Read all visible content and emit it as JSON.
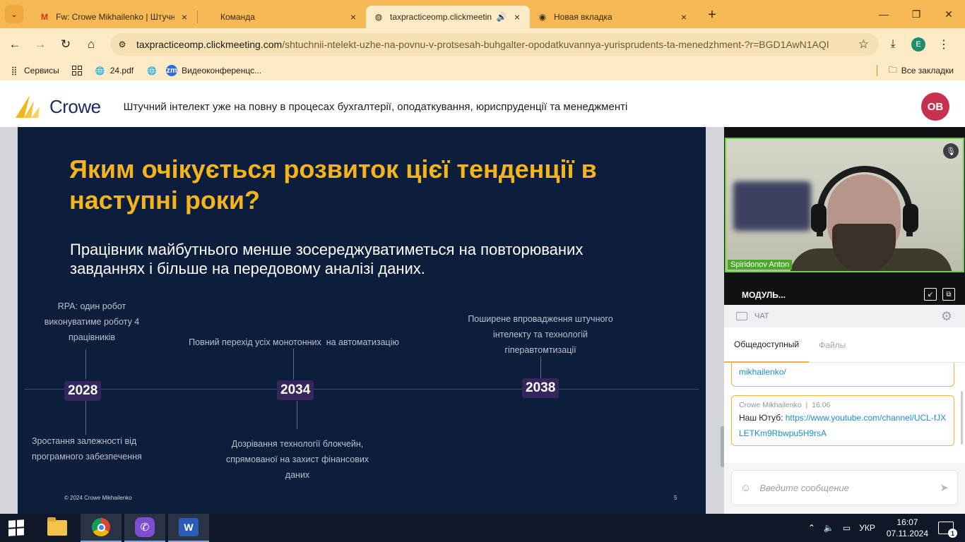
{
  "browser": {
    "tabs": [
      {
        "title": "Fw: Crowe Mikhailenko | Штучн",
        "icon": "gmail-icon",
        "active": false
      },
      {
        "title": "Команда",
        "icon": "",
        "active": false
      },
      {
        "title": "taxpracticeomp.clickmeeting",
        "icon": "web-icon",
        "active": true
      },
      {
        "title": "Новая вкладка",
        "icon": "chrome-icon",
        "active": false
      }
    ],
    "url_host": "taxpracticeomp.clickmeeting.com",
    "url_path": "/shtuchnii-ntelekt-uzhe-na-povnu-v-protsesah-buhgalter-opodatkuvannya-yurisprudents-ta-menedzhment-?r=BGD1AwN1AQI...",
    "profile_initial": "E",
    "bookmarks": [
      {
        "label": "Сервисы"
      },
      {
        "label": "24.pdf"
      },
      {
        "label": ""
      },
      {
        "label": "Видеоконференцс..."
      }
    ],
    "all_bookmarks": "Все закладки"
  },
  "app": {
    "logo_text": "Crowe",
    "webinar_title": "Штучний інтелект уже на повну в процесах бухгалтерії, оподаткування, юриспруденції та менеджменті",
    "user_initials": "OB"
  },
  "slide": {
    "title": "Яким очікується розвиток цієї тенденції в наступні роки?",
    "subtitle": "Працівник майбутнього менше зосереджуватиметься на повторюваних завданнях і більше на передовому аналізі даних.",
    "years": [
      "2028",
      "2034",
      "2038"
    ],
    "note_rpa": "RPA: один робот виконуватиме роботу 4 працівників",
    "note_transition": "Повний перехід усіх монотонних  на автоматизацію",
    "note_ai": "Поширене впровадження штучного інтелекту та технологій гіперавтомтизації",
    "note_dependency": "Зростання залежності від програмного забезпечення",
    "note_blockchain": "Дозрівання технології блокчейн, спрямованої на захист фінансових даних",
    "copyright": "© 2024 Crowe Mikhailenko",
    "page_number": "5"
  },
  "panel": {
    "participant_name": "Spiridonov Anton",
    "module_label": "МОДУЛЬ...",
    "chat_label": "ЧАТ",
    "tab_public": "Общедоступный",
    "tab_files": "Файлы",
    "msg1_link_tail": "mikhailenko/",
    "msg2_author": "Crowe Mikhailenko",
    "msg2_time": "16:06",
    "msg2_prefix": "Наш Ютуб: ",
    "msg2_link": "https://www.youtube.com/channel/UCL-fJXLETKm9Rbwpu5H9rsA",
    "input_placeholder": "Введите сообщение"
  },
  "taskbar": {
    "language": "УКР",
    "time": "16:07",
    "date": "07.11.2024",
    "notification_count": "1"
  }
}
